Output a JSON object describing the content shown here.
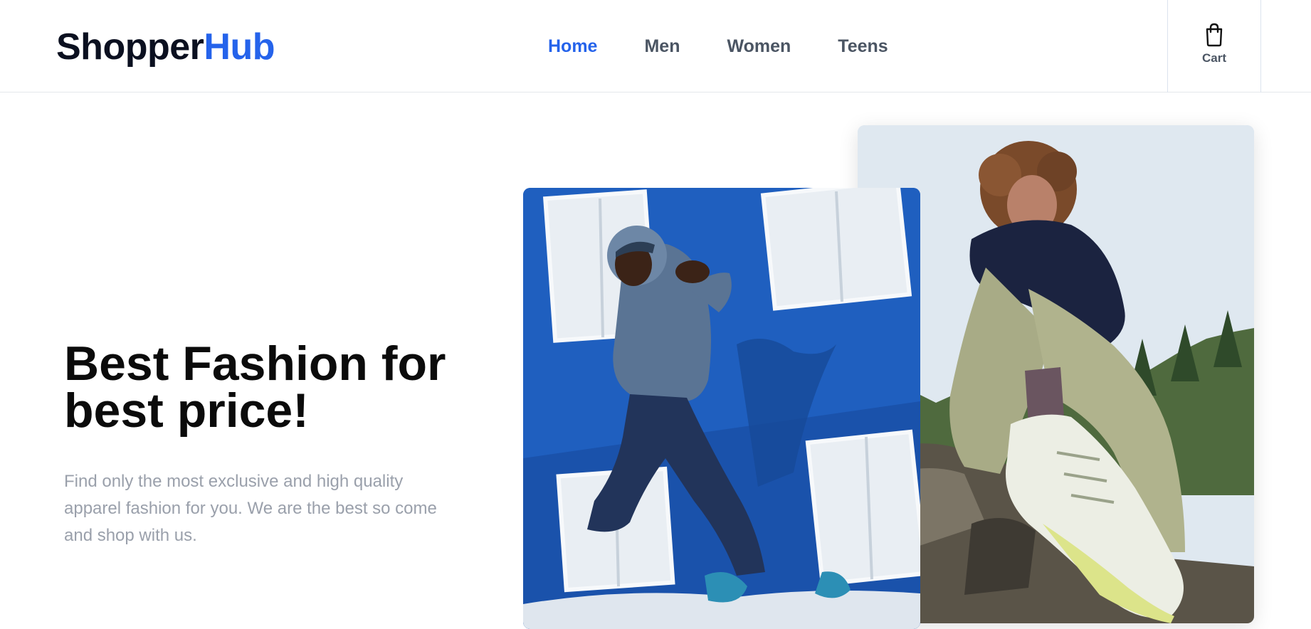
{
  "header": {
    "logo_part1": "Shopper",
    "logo_part2": "Hub",
    "nav": [
      {
        "label": "Home",
        "active": true
      },
      {
        "label": "Men",
        "active": false
      },
      {
        "label": "Women",
        "active": false
      },
      {
        "label": "Teens",
        "active": false
      }
    ],
    "cart_label": "Cart",
    "cart_icon": "shopping-bag-icon"
  },
  "hero": {
    "title": "Best Fashion for best price!",
    "subtitle": "Find only the most exclusive and high quality apparel fashion for you. We are the best so come and shop with us."
  },
  "colors": {
    "accent": "#2563eb",
    "nav_text": "#4b5563",
    "title": "#0b0b0b",
    "subtitle": "#9aa0ab"
  }
}
